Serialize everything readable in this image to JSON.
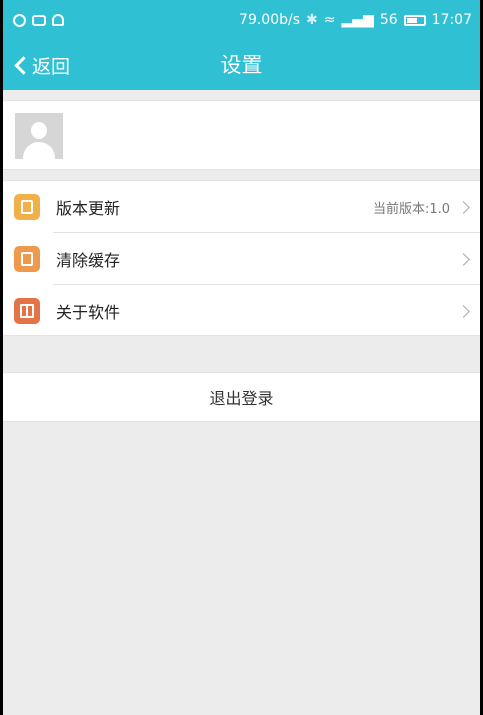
{
  "status_bar": {
    "network_speed": "79.00b/s",
    "signal": "56",
    "time": "17:07"
  },
  "navbar": {
    "back_label": "返回",
    "title": "设置"
  },
  "menu": {
    "items": [
      {
        "label": "版本更新",
        "value": "当前版本:1.0",
        "icon": "update-icon"
      },
      {
        "label": "清除缓存",
        "value": "",
        "icon": "trash-icon"
      },
      {
        "label": "关于软件",
        "value": "",
        "icon": "book-icon"
      }
    ]
  },
  "logout": {
    "label": "退出登录"
  },
  "colors": {
    "accent": "#2fc0d4",
    "background": "#ececec"
  }
}
